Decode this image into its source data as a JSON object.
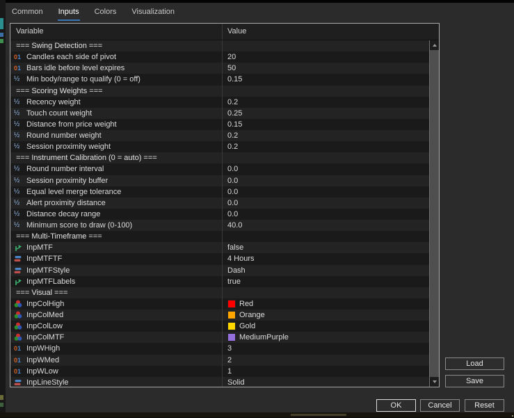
{
  "tabs": [
    {
      "label": "Common",
      "active": false
    },
    {
      "label": "Inputs",
      "active": true
    },
    {
      "label": "Colors",
      "active": false
    },
    {
      "label": "Visualization",
      "active": false
    }
  ],
  "table": {
    "columns": [
      "Variable",
      "Value"
    ],
    "rows": [
      {
        "kind": "section",
        "icon": "",
        "label": "=== Swing Detection ===",
        "value": ""
      },
      {
        "kind": "param",
        "icon": "integer",
        "label": "Candles each side of pivot",
        "value": "20"
      },
      {
        "kind": "param",
        "icon": "integer",
        "label": "Bars idle before level expires",
        "value": "50"
      },
      {
        "kind": "param",
        "icon": "double",
        "label": "Min body/range to qualify (0 = off)",
        "value": "0.15"
      },
      {
        "kind": "section",
        "icon": "",
        "label": "=== Scoring Weights ===",
        "value": ""
      },
      {
        "kind": "param",
        "icon": "double",
        "label": "Recency weight",
        "value": "0.2"
      },
      {
        "kind": "param",
        "icon": "double",
        "label": "Touch count weight",
        "value": "0.25"
      },
      {
        "kind": "param",
        "icon": "double",
        "label": "Distance from price weight",
        "value": "0.15"
      },
      {
        "kind": "param",
        "icon": "double",
        "label": "Round number weight",
        "value": "0.2"
      },
      {
        "kind": "param",
        "icon": "double",
        "label": "Session proximity weight",
        "value": "0.2"
      },
      {
        "kind": "section",
        "icon": "",
        "label": "=== Instrument Calibration (0 = auto) ===",
        "value": ""
      },
      {
        "kind": "param",
        "icon": "double",
        "label": "Round number interval",
        "value": "0.0"
      },
      {
        "kind": "param",
        "icon": "double",
        "label": "Session proximity buffer",
        "value": "0.0"
      },
      {
        "kind": "param",
        "icon": "double",
        "label": "Equal level merge tolerance",
        "value": "0.0"
      },
      {
        "kind": "param",
        "icon": "double",
        "label": "Alert proximity distance",
        "value": "0.0"
      },
      {
        "kind": "param",
        "icon": "double",
        "label": "Distance decay range",
        "value": "0.0"
      },
      {
        "kind": "param",
        "icon": "double",
        "label": "Minimum score to draw (0-100)",
        "value": "40.0"
      },
      {
        "kind": "section",
        "icon": "",
        "label": "=== Multi-Timeframe ===",
        "value": ""
      },
      {
        "kind": "param",
        "icon": "bool",
        "label": "InpMTF",
        "value": "false"
      },
      {
        "kind": "param",
        "icon": "enum",
        "label": "InpMTFTF",
        "value": "4 Hours"
      },
      {
        "kind": "param",
        "icon": "enum",
        "label": "InpMTFStyle",
        "value": "Dash"
      },
      {
        "kind": "param",
        "icon": "bool",
        "label": "InpMTFLabels",
        "value": "true"
      },
      {
        "kind": "section",
        "icon": "",
        "label": "=== Visual ===",
        "value": ""
      },
      {
        "kind": "param",
        "icon": "color",
        "label": "InpColHigh",
        "value": "Red",
        "swatch": "#ff0000"
      },
      {
        "kind": "param",
        "icon": "color",
        "label": "InpColMed",
        "value": "Orange",
        "swatch": "#ffa500"
      },
      {
        "kind": "param",
        "icon": "color",
        "label": "InpColLow",
        "value": "Gold",
        "swatch": "#ffd700"
      },
      {
        "kind": "param",
        "icon": "color",
        "label": "InpColMTF",
        "value": "MediumPurple",
        "swatch": "#9370db"
      },
      {
        "kind": "param",
        "icon": "integer",
        "label": "InpWHigh",
        "value": "3"
      },
      {
        "kind": "param",
        "icon": "integer",
        "label": "InpWMed",
        "value": "2"
      },
      {
        "kind": "param",
        "icon": "integer",
        "label": "InpWLow",
        "value": "1"
      },
      {
        "kind": "param",
        "icon": "enum",
        "label": "InpLineStyle",
        "value": "Solid"
      }
    ]
  },
  "side_buttons": [
    {
      "label": "Load"
    },
    {
      "label": "Save"
    }
  ],
  "bottom_buttons": [
    {
      "label": "OK",
      "primary": true
    },
    {
      "label": "Cancel",
      "primary": false
    },
    {
      "label": "Reset",
      "primary": false
    }
  ],
  "colors": {
    "tab_accent": "#3875b5",
    "swatch_red": "#ff0000",
    "swatch_orange": "#ffa500",
    "swatch_gold": "#ffd700",
    "swatch_mediumpurple": "#9370db"
  }
}
